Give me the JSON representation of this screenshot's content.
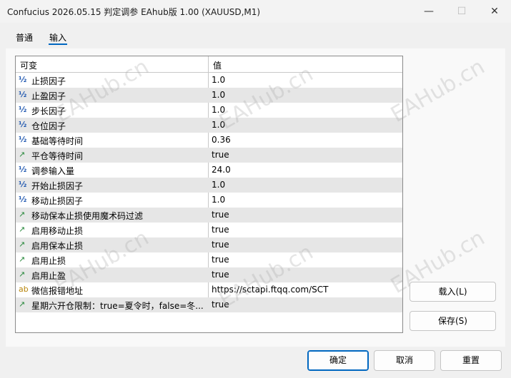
{
  "window": {
    "title": "Confucius 2026.05.15 判定调参 EAhub版 1.00 (XAUUSD,M1)",
    "minimize_glyph": "—",
    "maximize_glyph": "☐",
    "close_glyph": "✕"
  },
  "tabs": [
    {
      "label": "普通",
      "active": false
    },
    {
      "label": "输入",
      "active": true
    }
  ],
  "table": {
    "columns": [
      "可变",
      "值"
    ],
    "rows": [
      {
        "icon": "number-icon",
        "glyph": "½",
        "name": "止损因子",
        "value": "1.0"
      },
      {
        "icon": "number-icon",
        "glyph": "½",
        "name": "止盈因子",
        "value": "1.0"
      },
      {
        "icon": "number-icon",
        "glyph": "½",
        "name": "步长因子",
        "value": "1.0"
      },
      {
        "icon": "number-icon",
        "glyph": "½",
        "name": "仓位因子",
        "value": "1.0"
      },
      {
        "icon": "number-icon",
        "glyph": "½",
        "name": "基础等待时间",
        "value": "0.36"
      },
      {
        "icon": "bool-icon",
        "glyph": "↗",
        "name": "平仓等待时间",
        "value": "true"
      },
      {
        "icon": "number-icon",
        "glyph": "½",
        "name": "调参输入量",
        "value": "24.0"
      },
      {
        "icon": "number-icon",
        "glyph": "½",
        "name": "开始止损因子",
        "value": "1.0"
      },
      {
        "icon": "number-icon",
        "glyph": "½",
        "name": "移动止损因子",
        "value": "1.0"
      },
      {
        "icon": "bool-icon",
        "glyph": "↗",
        "name": "移动保本止损使用魔术码过滤",
        "value": "true"
      },
      {
        "icon": "bool-icon",
        "glyph": "↗",
        "name": "启用移动止损",
        "value": "true"
      },
      {
        "icon": "bool-icon",
        "glyph": "↗",
        "name": "启用保本止损",
        "value": "true"
      },
      {
        "icon": "bool-icon",
        "glyph": "↗",
        "name": "启用止损",
        "value": "true"
      },
      {
        "icon": "bool-icon",
        "glyph": "↗",
        "name": "启用止盈",
        "value": "true"
      },
      {
        "icon": "string-icon",
        "glyph": "ab",
        "name": "微信报错地址",
        "value": "https://sctapi.ftqq.com/SCT"
      },
      {
        "icon": "bool-icon",
        "glyph": "↗",
        "name": "星期六开仓限制：true=夏令时，false=冬...",
        "value": "true"
      }
    ]
  },
  "side_buttons": {
    "load": "载入(L)",
    "save": "保存(S)"
  },
  "footer_buttons": {
    "ok": "确定",
    "cancel": "取消",
    "reset": "重置"
  },
  "watermark": "EAHub.cn",
  "colors": {
    "accent": "#0067c0",
    "alt_row": "#e6e6e6"
  }
}
